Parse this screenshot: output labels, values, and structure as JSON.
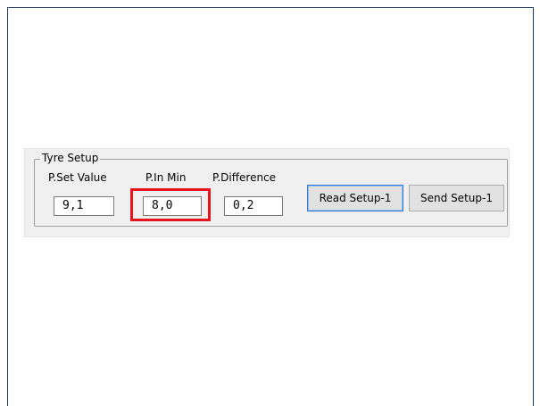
{
  "tyre_setup": {
    "title": "Tyre Setup",
    "fields": [
      {
        "label": "P.Set Value",
        "value": "9,1"
      },
      {
        "label": "P.In Min",
        "value": "8,0",
        "highlighted": true
      },
      {
        "label": "P.Difference",
        "value": "0,2"
      }
    ],
    "buttons": {
      "read": "Read Setup-1",
      "send": "Send Setup-1"
    }
  },
  "colors": {
    "highlight": "#e4151f",
    "panel_background": "#f0f0f0"
  }
}
